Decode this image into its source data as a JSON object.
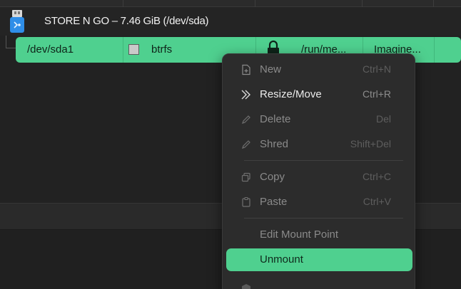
{
  "device": {
    "label": "STORE N GO – 7.46 GiB (/dev/sda)",
    "icon": "usb-drive-icon"
  },
  "partition": {
    "path": "/dev/sda1",
    "filesystem": "btrfs",
    "fs_color": "#c9c9c9",
    "locked_icon": "lock-icon",
    "mount_point": "/run/me...",
    "label": "Imagine...",
    "row_color": "#4fd08f"
  },
  "context_menu": {
    "items": [
      {
        "label": "New",
        "shortcut": "Ctrl+N",
        "icon": "new-icon",
        "enabled": false
      },
      {
        "label": "Resize/Move",
        "shortcut": "Ctrl+R",
        "icon": "resize-icon",
        "enabled": true
      },
      {
        "label": "Delete",
        "shortcut": "Del",
        "icon": "delete-icon",
        "enabled": false
      },
      {
        "label": "Shred",
        "shortcut": "Shift+Del",
        "icon": "shred-icon",
        "enabled": false
      },
      {
        "label": "Copy",
        "shortcut": "Ctrl+C",
        "icon": "copy-icon",
        "enabled": false
      },
      {
        "label": "Paste",
        "shortcut": "Ctrl+V",
        "icon": "paste-icon",
        "enabled": false
      },
      {
        "label": "Edit Mount Point",
        "shortcut": "",
        "icon": "",
        "enabled": false
      },
      {
        "label": "Unmount",
        "shortcut": "",
        "icon": "",
        "enabled": true,
        "highlighted": true
      }
    ],
    "highlight_color": "#4fd08f"
  }
}
